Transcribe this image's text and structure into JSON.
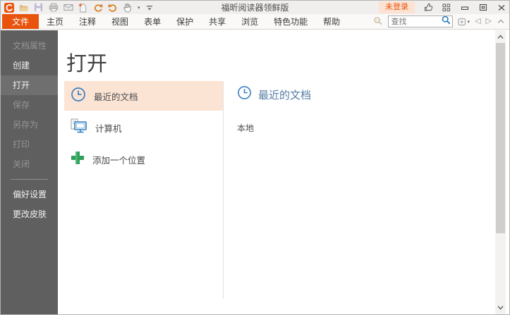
{
  "window": {
    "title": "福昕阅读器领鲜版"
  },
  "titlebar": {
    "login_label": "未登录",
    "qat_sep": "⁞"
  },
  "menubar": {
    "tabs": [
      "文件",
      "主页",
      "注释",
      "视图",
      "表单",
      "保护",
      "共享",
      "浏览",
      "特色功能",
      "帮助"
    ]
  },
  "search": {
    "placeholder": "查找",
    "prev_glyph": "◁",
    "next_glyph": "▷"
  },
  "sidebar": {
    "items": [
      "文档属性",
      "创建",
      "打开",
      "保存",
      "另存为",
      "打印",
      "关闭",
      "偏好设置",
      "更改皮肤"
    ]
  },
  "main": {
    "heading": "打开",
    "locations": [
      {
        "label": "最近的文档",
        "icon": "clock",
        "selected": true
      },
      {
        "label": "计算机",
        "icon": "computer",
        "selected": false
      },
      {
        "label": "添加一个位置",
        "icon": "plus",
        "selected": false
      }
    ],
    "recent": {
      "heading": "最近的文档",
      "group": "本地"
    }
  },
  "colors": {
    "accent_orange": "#e8540e",
    "selected_peach": "#fce4d4",
    "accent_blue": "#3e7fc1",
    "heading_blue": "#557ca5",
    "sidebar_gray": "#5f5f5f",
    "plus_green": "#2fa05c"
  }
}
